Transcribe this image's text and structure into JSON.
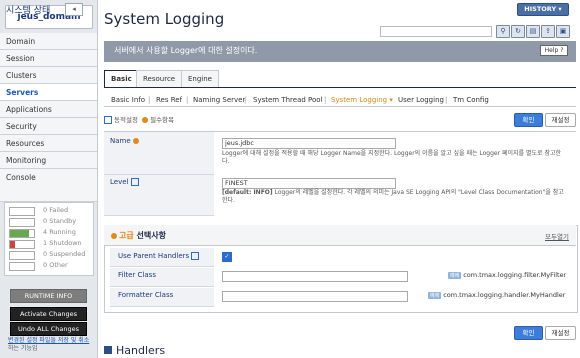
{
  "sidebar": {
    "domain": "jeus_domain",
    "items": [
      {
        "label": "Domain"
      },
      {
        "label": "Session"
      },
      {
        "label": "Clusters"
      },
      {
        "label": "Servers"
      },
      {
        "label": "Applications"
      },
      {
        "label": "Security"
      },
      {
        "label": "Resources"
      },
      {
        "label": "Monitoring"
      },
      {
        "label": "Console"
      }
    ],
    "system_state_label": "시스템 상태",
    "states": [
      {
        "label": "0 Failed",
        "fill": 0
      },
      {
        "label": "0 Standby",
        "fill": 0
      },
      {
        "label": "4 Running",
        "fill": 0.8,
        "color": "#6aa84f"
      },
      {
        "label": "1 Shutdown",
        "fill": 0.2,
        "color": "#cc4444"
      },
      {
        "label": "0 Suspended",
        "fill": 0
      },
      {
        "label": "0 Other",
        "fill": 0
      }
    ],
    "runtime_info": "RUNTIME INFO",
    "activate_changes": "Activate Changes",
    "undo_all_changes": "Undo ALL Changes",
    "note_link": "변경된 설정 파일들 저장 및 취소",
    "note_rest": "하는 기능입"
  },
  "header": {
    "title": "System Logging",
    "history": "HISTORY ▾",
    "description": "서버에서 사용할 Logger에 대한 설정이다.",
    "help": "Help ?"
  },
  "tabs": [
    {
      "label": "Basic"
    },
    {
      "label": "Resource"
    },
    {
      "label": "Engine"
    }
  ],
  "subtabs": [
    {
      "label": "Basic Info"
    },
    {
      "label": "Res Ref"
    },
    {
      "label": "Naming Server"
    },
    {
      "label": "System Thread Pool"
    },
    {
      "label": "System Logging ▾"
    },
    {
      "label": "User Logging"
    },
    {
      "label": "Tm Config"
    }
  ],
  "legend": {
    "dynamic": "동적설정",
    "required": "필수항목"
  },
  "buttons": {
    "confirm": "확인",
    "reset": "재설정"
  },
  "form": {
    "name_label": "Name",
    "name_value": "jeus.jdbc",
    "name_help": "Logger에 대해 설정을 적용할 때 해당 Logger Name을 지정한다. Logger의 이름을 알고 싶을 때는 Logger 페이지를 별도로 참고한다.",
    "level_label": "Level",
    "level_value": "FINEST",
    "level_default": "[default: INFO]",
    "level_help": "Logger의 레벨을 설정한다. 각 레벨의 의미는 Java SE Logging API의 \"Level Class Documentation\"을 참고한다."
  },
  "advanced": {
    "prefix": "고급",
    "title": " 선택사항",
    "toggle": "모두열기",
    "use_parent_label": "Use Parent Handlers",
    "filter_label": "Filter Class",
    "filter_value": "com.tmax.logging.filter.MyFilter",
    "formatter_label": "Formatter Class",
    "formatter_value": "com.tmax.logging.handler.MyHandler",
    "badge": "예제"
  },
  "handlers": {
    "title": "Handlers"
  }
}
